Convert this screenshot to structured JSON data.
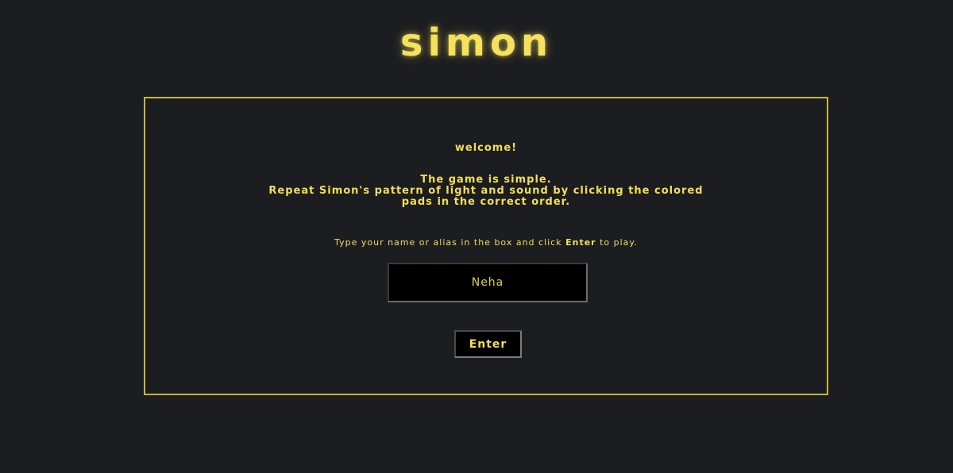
{
  "header": {
    "title": "simon"
  },
  "intro": {
    "welcome": "welcome!",
    "rules_line1": "The game is simple.",
    "rules_line2": "Repeat Simon's pattern of light and sound by clicking the colored",
    "rules_line3": "pads in the correct order.",
    "instructions_before": "Type your name or alias in the box and click ",
    "instructions_emphasis": "Enter",
    "instructions_after": " to play."
  },
  "name_input": {
    "value": "Neha",
    "placeholder": ""
  },
  "enter_button": {
    "label": "Enter"
  },
  "colors": {
    "accent": "#f2de57",
    "background": "#1c1d20",
    "panel_border": "#c9b541"
  }
}
